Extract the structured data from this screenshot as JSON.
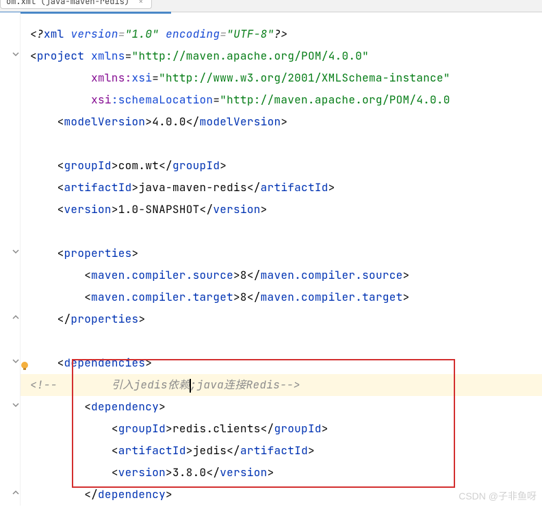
{
  "tab": {
    "label": "om.xml (java-maven-redis)"
  },
  "code": {
    "xml_decl_open": "<?",
    "xml_decl_name": "xml",
    "xml_version_attr": "version",
    "xml_version_val": "\"1.0\"",
    "xml_enc_attr": "encoding",
    "xml_enc_val": "\"UTF-8\"",
    "xml_decl_close": "?>",
    "project_tag": "project",
    "xmlns_attr": "xmlns",
    "xmlns_val": "\"http://maven.apache.org/POM/4.0.0\"",
    "xmlns_xsi_ns": "xmlns:",
    "xmlns_xsi": "xsi",
    "xmlns_xsi_val": "\"http://www.w3.org/2001/XMLSchema-instance\"",
    "xsi_ns": "xsi",
    "schemaLoc_attr": ":schemaLocation",
    "schemaLoc_val": "\"http://maven.apache.org/POM/4.0.0",
    "modelVersion_tag": "modelVersion",
    "modelVersion_val": "4.0.0",
    "groupId_tag": "groupId",
    "groupId_val": "com.wt",
    "artifactId_tag": "artifactId",
    "artifactId_val": "java-maven-redis",
    "version_tag": "version",
    "version_val": "1.0-SNAPSHOT",
    "properties_tag": "properties",
    "mvn_src_tag": "maven.compiler.source",
    "mvn_src_val": "8",
    "mvn_tgt_tag": "maven.compiler.target",
    "mvn_tgt_val": "8",
    "dependencies_tag": "dependencies",
    "comment_open": "<!--",
    "comment_text": "引入jedis依赖",
    "comment_text2": ";java连接Redis-->",
    "dependency_tag": "dependency",
    "dep_groupId_val": "redis.clients",
    "dep_artifactId_val": "jedis",
    "dep_version_val": "3.8.0"
  },
  "watermark": "CSDN @子非鱼呀"
}
